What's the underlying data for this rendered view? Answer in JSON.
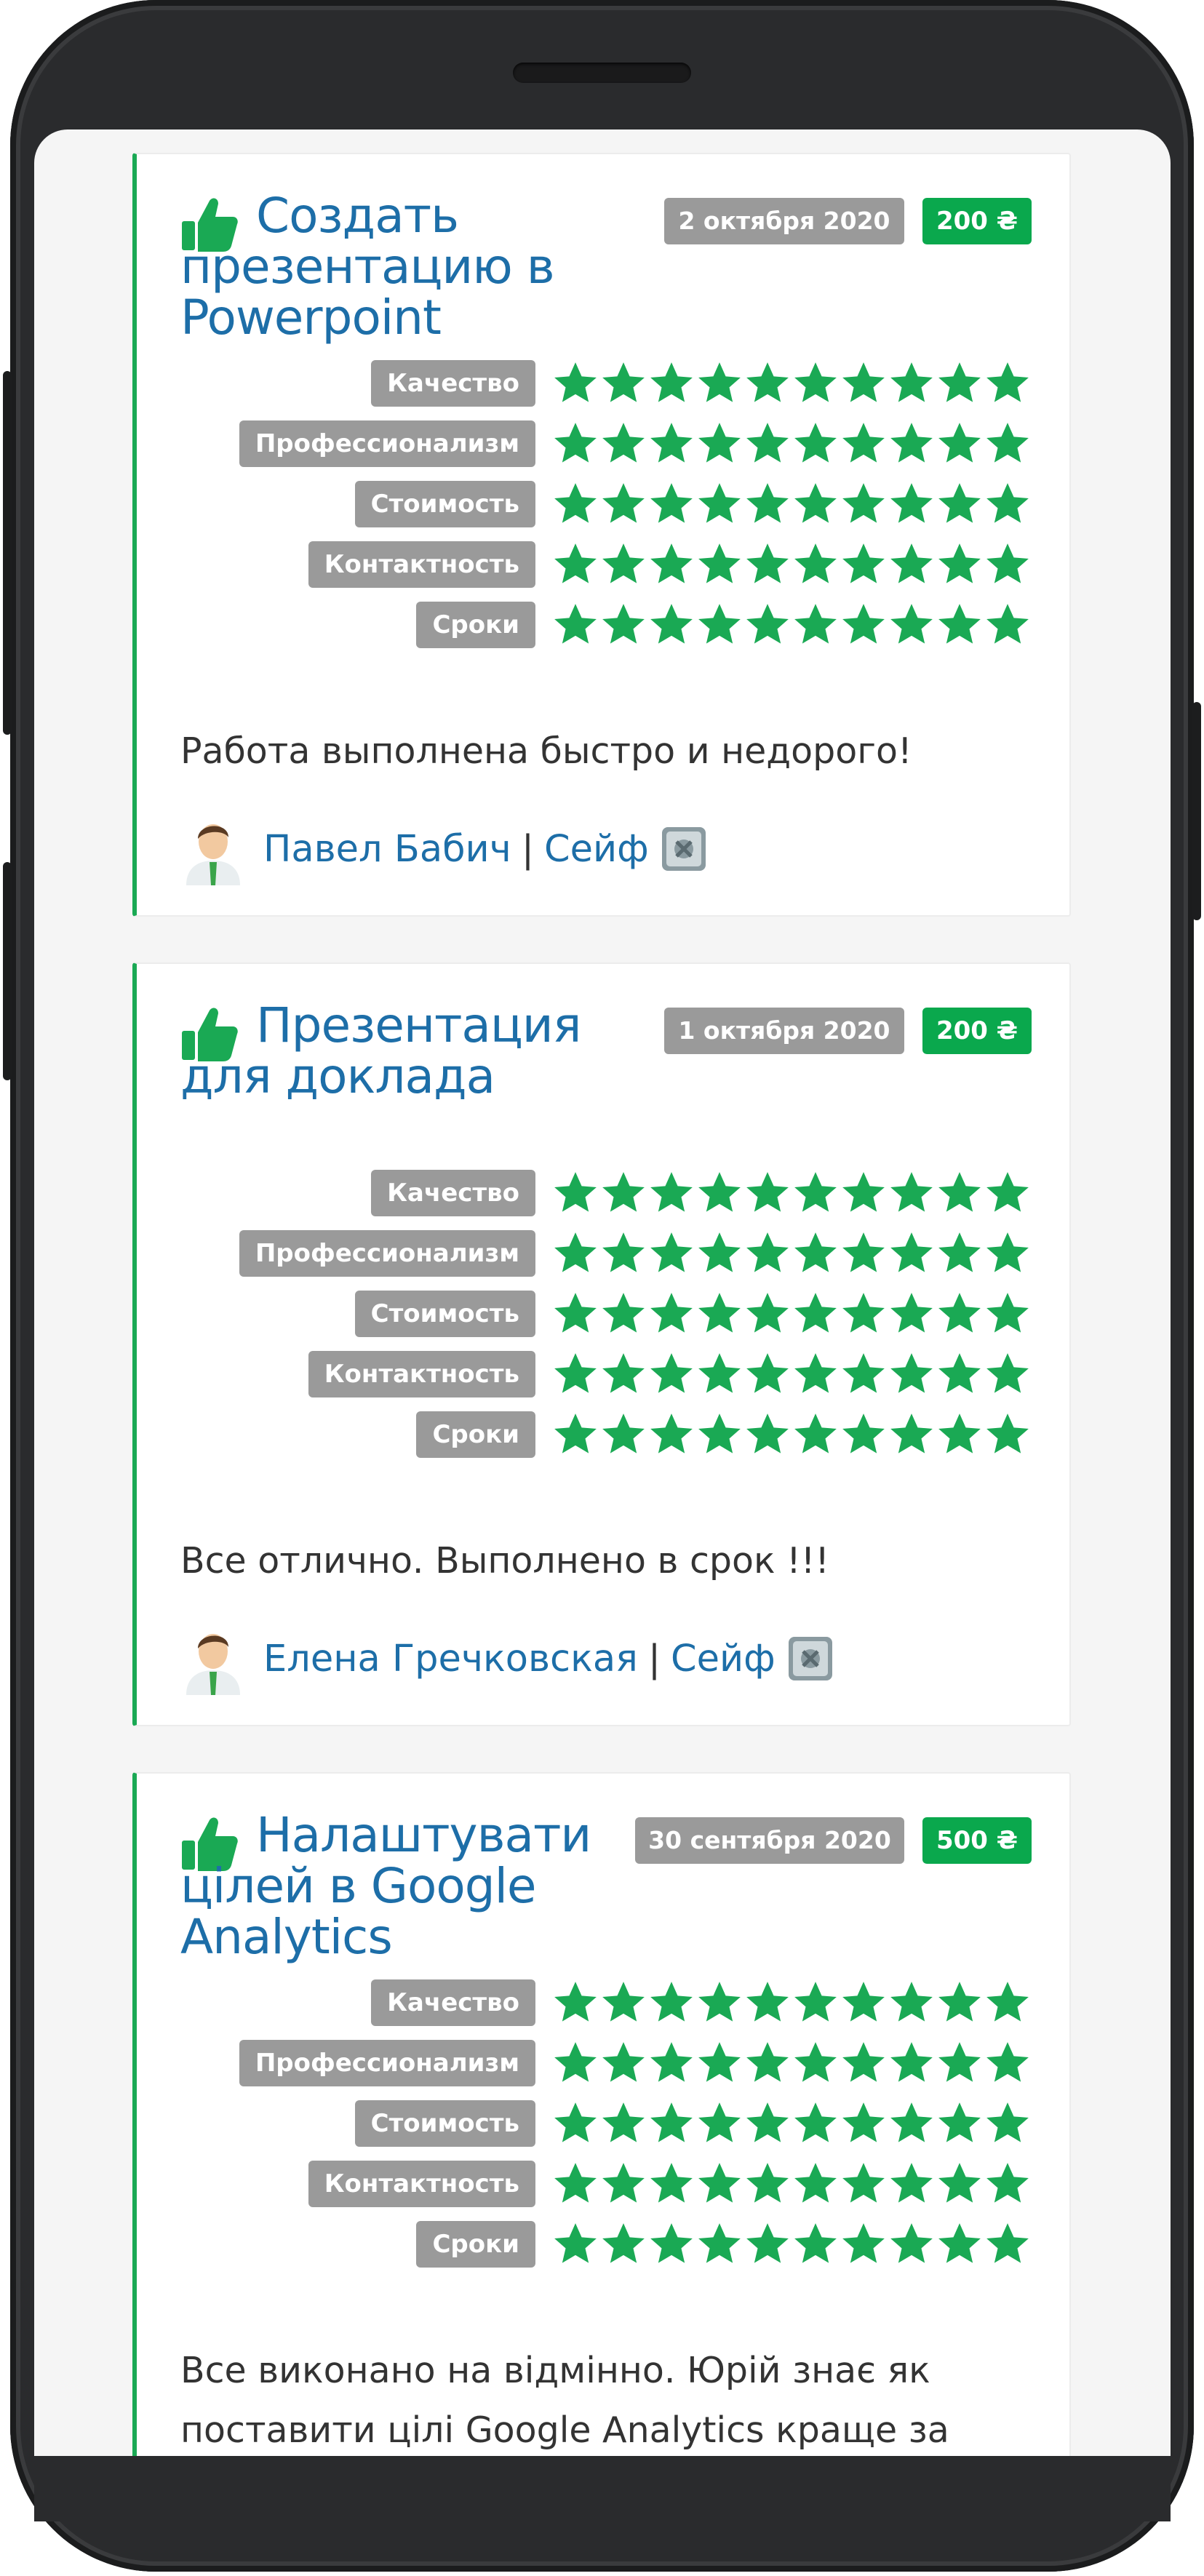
{
  "colors": {
    "accent_green": "#0aa84d",
    "star_green": "#1aa954",
    "link_blue": "#1d6ea8",
    "badge_gray": "#9a9a9a",
    "phone_frame": "#2a2b2d"
  },
  "reviews": [
    {
      "title": "Создать презентацию в Powerpoint",
      "date": "2 октября 2020",
      "price": "200 ₴",
      "ratings": [
        {
          "label": "Качество",
          "stars": 10
        },
        {
          "label": "Профессионализм",
          "stars": 10
        },
        {
          "label": "Стоимость",
          "stars": 10
        },
        {
          "label": "Контактность",
          "stars": 10
        },
        {
          "label": "Сроки",
          "stars": 10
        }
      ],
      "comment": "Работа выполнена быстро и недорого!",
      "author": "Павел Бабич",
      "separator": "|",
      "safe_label": "Сейф",
      "icons": {
        "thumb": "thumbs-up-icon",
        "avatar": "user-avatar-icon",
        "safe": "safe-icon"
      }
    },
    {
      "title": "Презентация для доклада",
      "date": "1 октября 2020",
      "price": "200 ₴",
      "ratings": [
        {
          "label": "Качество",
          "stars": 10
        },
        {
          "label": "Профессионализм",
          "stars": 10
        },
        {
          "label": "Стоимость",
          "stars": 10
        },
        {
          "label": "Контактность",
          "stars": 10
        },
        {
          "label": "Сроки",
          "stars": 10
        }
      ],
      "comment": "Все отлично. Выполнено в срок !!!",
      "author": "Елена Гречковская",
      "separator": "|",
      "safe_label": "Сейф",
      "icons": {
        "thumb": "thumbs-up-icon",
        "avatar": "user-avatar-icon",
        "safe": "safe-icon"
      }
    },
    {
      "title": "Налаштувати цілей в Google Analytics",
      "date": "30 сентября 2020",
      "price": "500 ₴",
      "ratings": [
        {
          "label": "Качество",
          "stars": 10
        },
        {
          "label": "Профессионализм",
          "stars": 10
        },
        {
          "label": "Стоимость",
          "stars": 10
        },
        {
          "label": "Контактность",
          "stars": 10
        },
        {
          "label": "Сроки",
          "stars": 10
        }
      ],
      "comment": "Все виконано на відмінно. Юрій знає як поставити цілі Google Analytics краще за",
      "icons": {
        "thumb": "thumbs-up-icon"
      }
    }
  ]
}
